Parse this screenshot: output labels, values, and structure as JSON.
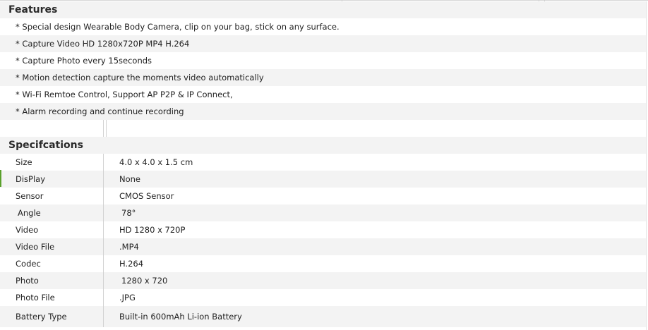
{
  "features": {
    "heading": "Features",
    "items": [
      "* Special design Wearable Body Camera, clip on your bag, stick on any surface.",
      "*  Capture Video HD 1280x720P MP4 H.264",
      "*  Capture Photo every 15seconds",
      "*  Motion detection capture the moments video automatically",
      "* Wi-Fi Remtoe Control, Support AP P2P & IP Connect,",
      "*  Alarm recording and continue recording"
    ]
  },
  "specifications": {
    "heading": "Specifcations",
    "rows": [
      {
        "label": "Size",
        "value": "4.0 x 4.0 x 1.5 cm"
      },
      {
        "label": "DisPlay",
        "value": "None"
      },
      {
        "label": "Sensor",
        "value": "CMOS Sensor"
      },
      {
        "label": "Angle",
        "value": "78°"
      },
      {
        "label": "Video",
        "value": "HD 1280 x 720P"
      },
      {
        "label": "Video File",
        "value": ".MP4"
      },
      {
        "label": "Codec",
        "value": "H.264"
      },
      {
        "label": "Photo",
        "value": "1280 x 720"
      },
      {
        "label": "Photo File",
        "value": ".JPG"
      },
      {
        "label": "Battery Type",
        "value": "Built-in 600mAh Li-ion Battery"
      }
    ]
  },
  "colors": {
    "row_shade": "#f3f3f3",
    "divider": "#d2d2d2",
    "accent_mark": "#5aa02c"
  }
}
